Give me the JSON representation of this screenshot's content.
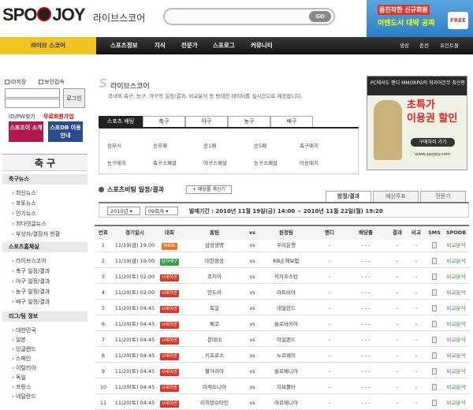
{
  "header": {
    "logo": [
      "SPO",
      "JOY"
    ],
    "site_title": "라이브스코어",
    "search": {
      "placeholder": "",
      "go_label": "GO"
    },
    "ad_top": {
      "line1": "음진작한 신규회원",
      "line2": "이벤도서 대박 공짜",
      "badge": "FREE"
    }
  },
  "nav": {
    "live_label": "라이브 스코어",
    "items": [
      "스포츠정보",
      "지식",
      "전문가",
      "스포로그",
      "커뮤니티"
    ],
    "right": [
      "생정",
      "충전",
      "포인트몰"
    ]
  },
  "login": {
    "remember_id": "ID저장",
    "secure": "보안접속",
    "login_btn": "로그인",
    "find_link": "ID/PW찾기",
    "join_link": "무료회원가입",
    "intro_btn": "스포조이 소개",
    "guide_btn": "스포DB 이용안내"
  },
  "sidebar": {
    "section_title": "축 구",
    "news_header": "축구뉴스",
    "news_items": [
      "최신뉴스",
      "포토뉴스",
      "인기뉴스",
      "최다댓글뉴스",
      "부상자/결장자 현황"
    ],
    "sched_header": "스포츠홈체실",
    "sched_items": [
      "라이브스코어",
      "축구 일정/결과",
      "야구 일정/결과",
      "농구 일정/결과",
      "배구 일정/결과"
    ],
    "league_header": "리그/팀 정보",
    "league_items": [
      "대한민국",
      "일본",
      "잉글랜드",
      "스페인",
      "이탈리아",
      "독일",
      "프랑스",
      "네덜란드"
    ]
  },
  "main": {
    "logo_text": "S",
    "title": "라이브스코어",
    "desc": "국내외 축구, 농구, 야구의 일정/결과, 비교분석 등 방대한 데이터를 실시간으로 제공합니다.",
    "tabs": [
      "스포츠 배팅",
      "축구",
      "야구",
      "농구",
      "배구"
    ],
    "sports_rows": [
      [
        "승부식",
        "승무패",
        "승1패",
        "승5패",
        "축구매치"
      ],
      [
        "농구매치",
        "축구스페셜",
        "야구스페셜",
        "농구스페셜",
        "어농매치"
      ]
    ],
    "section_title": "스포츠비팅 일정/결과",
    "calendar_btn": "+ 배당률 계산기",
    "right_tabs": [
      "방정/결과",
      "예상투표",
      "전문가"
    ],
    "year_select": "2010년",
    "round_select": "09회차",
    "period": "발매기간 : 2010년 11월 19일(금) 14:00 ~ 2010년 11월 22일(월) 19:20"
  },
  "table": {
    "headers": [
      "번호",
      "경기일시",
      "대회",
      "홈팀",
      "vs",
      "원정팀",
      "핸디",
      "배당률",
      "결과",
      "비교",
      "SMS",
      "SPODB"
    ],
    "rows": [
      {
        "no": "1",
        "time": "11/19(금) 19:00",
        "league": "WKBL",
        "home": "삼성생명",
        "vs": "vs",
        "away": "우리은행",
        "handi": "-",
        "odds": "-  -  -",
        "result": "-",
        "cmp": "-",
        "db": "비교분석"
      },
      {
        "no": "2",
        "time": "11/19(금) 19:00",
        "league": "남자배구",
        "home": "대한항공",
        "vs": "vs",
        "away": "KB손해보험",
        "handi": "-",
        "odds": "-  -  -",
        "result": "-",
        "cmp": "-",
        "db": "비교분석"
      },
      {
        "no": "3",
        "time": "11/20(토) 02:00",
        "league": "U네이션",
        "home": "조지아",
        "vs": "vs",
        "away": "카자흐스탄",
        "handi": "-",
        "odds": "-  -  -",
        "result": "-",
        "cmp": "-",
        "db": "비교분석"
      },
      {
        "no": "4",
        "time": "11/20(토) 02:00",
        "league": "U네이션",
        "home": "안도라",
        "vs": "vs",
        "away": "라트비아",
        "handi": "-",
        "odds": "-  -  -",
        "result": "-",
        "cmp": "-",
        "db": "비교분석"
      },
      {
        "no": "5",
        "time": "11/20(토) 04:45",
        "league": "U네이션",
        "home": "독일",
        "vs": "vs",
        "away": "네덜란드",
        "handi": "-",
        "odds": "-  -  -",
        "result": "-",
        "cmp": "-",
        "db": "비교분석"
      },
      {
        "no": "6",
        "time": "11/20(토) 04:45",
        "league": "U네이션",
        "home": "체코",
        "vs": "vs",
        "away": "슬로바키아",
        "handi": "-",
        "odds": "-  -  -",
        "result": "-",
        "cmp": "-",
        "db": "비교분석"
      },
      {
        "no": "7",
        "time": "11/20(토) 04:45",
        "league": "U네이션",
        "home": "몬테네",
        "vs": "vs",
        "away": "아일랜드",
        "handi": "-",
        "odds": "-  -  -",
        "result": "-",
        "cmp": "-",
        "db": "비교분석"
      },
      {
        "no": "8",
        "time": "11/20(토) 04:45",
        "league": "U네이션",
        "home": "키프로스",
        "vs": "vs",
        "away": "노르웨이",
        "handi": "-",
        "odds": "-  -  -",
        "result": "-",
        "cmp": "-",
        "db": "비교분석"
      },
      {
        "no": "9",
        "time": "11/20(토) 04:45",
        "league": "U네이션",
        "home": "불가리아",
        "vs": "vs",
        "away": "슬로베니아",
        "handi": "-",
        "odds": "-  -  -",
        "result": "-",
        "cmp": "-",
        "db": "비교분석"
      },
      {
        "no": "10",
        "time": "11/20(토) 04:45",
        "league": "U네이션",
        "home": "마케도니아",
        "vs": "vs",
        "away": "지브롤터",
        "handi": "-",
        "odds": "-  -  -",
        "result": "-",
        "cmp": "-",
        "db": "비교분석"
      },
      {
        "no": "11",
        "time": "11/20(토) 04:45",
        "league": "U네이션",
        "home": "리히텐슈타인",
        "vs": "vs",
        "away": "아르메니아",
        "handi": "-",
        "odds": "-  -  -",
        "result": "-",
        "cmp": "-",
        "db": "비교분석"
      }
    ]
  },
  "right_ad": {
    "head": "PC에서도 핸디 MMORPG의 워리어본무 최신판",
    "big1": "초특가",
    "big2": "이용권 할인",
    "go": "구매하러 가기",
    "url": "www.spojoy.com"
  },
  "colors": {
    "accent": "#f3c322",
    "nav_bg": "#222222",
    "wkbl": "#e8762c",
    "volley": "#3aa14a",
    "unation": "#d9392b",
    "link_green": "#3a8a3a"
  }
}
